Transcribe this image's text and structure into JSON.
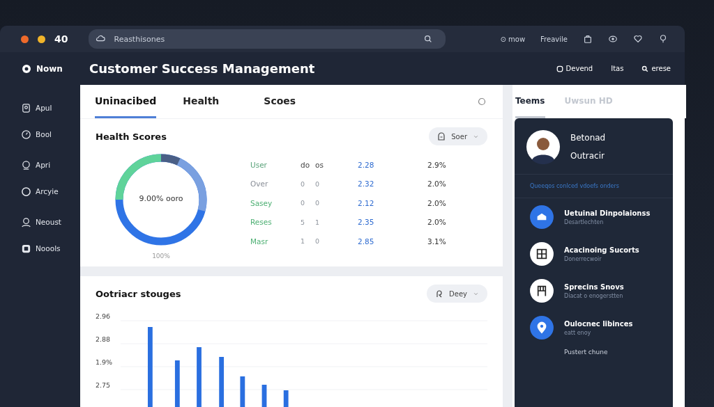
{
  "window": {
    "counter": "40",
    "search": {
      "placeholder": "Reasthisones"
    },
    "toolbar": [
      {
        "kind": "text",
        "label": "⊙ mow"
      },
      {
        "kind": "text",
        "label": "Freavile"
      },
      {
        "kind": "bag"
      },
      {
        "kind": "eye"
      },
      {
        "kind": "heart"
      },
      {
        "kind": "pin"
      }
    ]
  },
  "brand": "Nown",
  "page_title": "Customer Success Management",
  "header_actions": [
    {
      "kind": "square",
      "label": "Devend"
    },
    {
      "kind": "plain",
      "label": "Itas"
    },
    {
      "kind": "search",
      "label": "erese"
    }
  ],
  "sidebar": {
    "items": [
      {
        "label": "Apul"
      },
      {
        "label": "Bool"
      },
      {
        "label": "Apri"
      },
      {
        "label": "Arcyie"
      },
      {
        "label": "Neoust"
      },
      {
        "label": "Noools"
      }
    ]
  },
  "tabs": [
    {
      "label": "Uninacibed",
      "selected": true
    },
    {
      "label": "Health",
      "selected": false
    },
    {
      "label": "Scoes",
      "selected": false
    }
  ],
  "health": {
    "title": "Health Scores",
    "filter": "Soer",
    "donut_label": "9.00% ooro",
    "donut_caption": "100%",
    "rows": [
      {
        "name": "User",
        "color": "#5aa37a",
        "a": "do",
        "b": "os",
        "score": "2.28",
        "pct": "2.9%"
      },
      {
        "name": "Over",
        "color": "#8a8f98",
        "a": "0",
        "b": "0",
        "score": "2.32",
        "pct": "2.0%"
      },
      {
        "name": "Sasey",
        "color": "#4caf72",
        "a": "0",
        "b": "0",
        "score": "2.12",
        "pct": "2.0%"
      },
      {
        "name": "Reses",
        "color": "#4caf72",
        "a": "5",
        "b": "1",
        "score": "2.35",
        "pct": "2.0%"
      },
      {
        "name": "Masr",
        "color": "#4caf72",
        "a": "1",
        "b": "0",
        "score": "2.85",
        "pct": "3.1%"
      }
    ]
  },
  "outreach": {
    "title": "Ootriacr stouges",
    "filter": "Deey",
    "axis_labels": [
      "2.96",
      "2.88",
      "1.9%",
      "2.75"
    ]
  },
  "right_tabs": [
    {
      "label": "Teems",
      "selected": true
    },
    {
      "label": "Uwsun HD",
      "selected": false
    }
  ],
  "profile": {
    "line1": "Betonad",
    "line2": "Outracir",
    "note": "Queeqos conlced vdoefs onders",
    "items": [
      {
        "accent": true,
        "title": "Uetuinal Dinpolaionss",
        "sub": "Desartlechten"
      },
      {
        "accent": false,
        "title": "Acacinoing Sucorts",
        "sub": "Donerrecwoir"
      },
      {
        "accent": false,
        "title": "Sprecins Snovs",
        "sub": "Diacat o enogerstten"
      },
      {
        "accent": true,
        "title": "Oulocnec libinces",
        "sub": "eatt enoy"
      }
    ],
    "footer": "Pustert chune"
  }
}
